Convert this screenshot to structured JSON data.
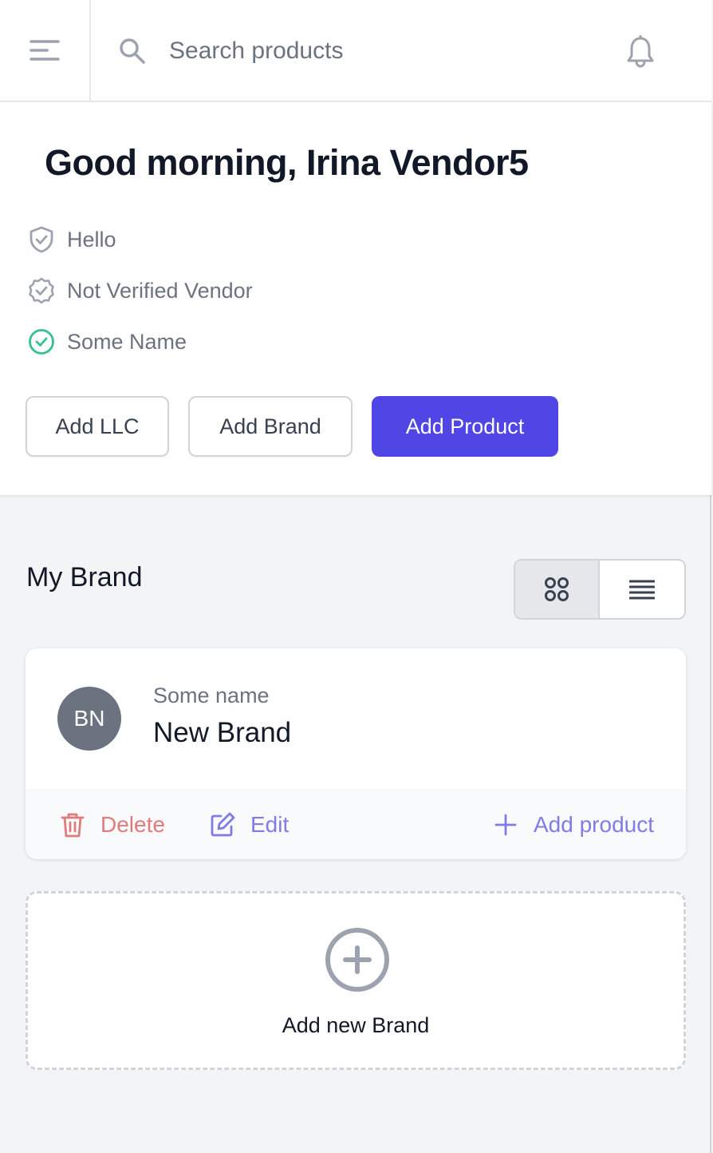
{
  "topbar": {
    "menu_icon": "menu-alt-icon",
    "search": {
      "icon": "search-icon",
      "placeholder": "Search products",
      "value": ""
    },
    "notifications_icon": "bell-icon"
  },
  "greeting": {
    "title": "Good morning, Irina Vendor5",
    "badges": [
      {
        "icon": "shield-check-icon",
        "label": "Hello",
        "color": "#9ca3af"
      },
      {
        "icon": "badge-check-icon",
        "label": "Not Verified Vendor",
        "color": "#9ca3af"
      },
      {
        "icon": "check-circle-icon",
        "label": "Some Name",
        "color": "#34c38f"
      }
    ],
    "buttons": {
      "add_llc": "Add LLC",
      "add_brand": "Add Brand",
      "add_product": "Add Product"
    }
  },
  "brands_section": {
    "title": "My Brand",
    "view_toggle": {
      "options": [
        "grid",
        "list"
      ],
      "selected": "grid"
    },
    "brands": [
      {
        "initials": "BN",
        "subtitle": "Some name",
        "name": "New Brand",
        "actions": {
          "delete": "Delete",
          "edit": "Edit",
          "add_product": "Add product"
        }
      }
    ],
    "add_new_label": "Add new Brand"
  },
  "colors": {
    "primary": "#4f46e5",
    "danger": "#e07b7b",
    "link": "#7f7ce6",
    "success": "#34c38f",
    "avatar_bg": "#6b7280"
  }
}
